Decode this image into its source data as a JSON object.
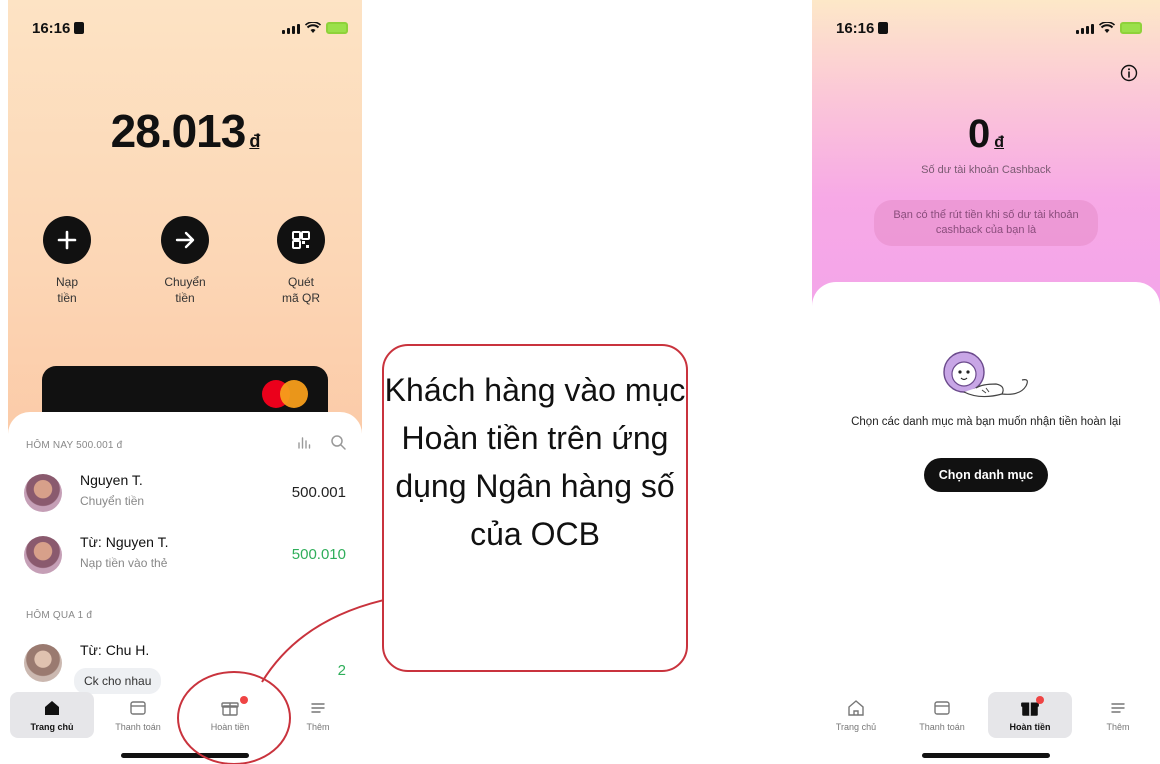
{
  "left_phone": {
    "status_time": "16:16",
    "balance": "28.013",
    "currency": "đ",
    "actions": [
      {
        "label": "Nạp\ntiền",
        "icon": "plus-icon"
      },
      {
        "label": "Chuyển\ntiền",
        "icon": "arrow-right-icon"
      },
      {
        "label": "Quét\nmã QR",
        "icon": "qr-icon"
      }
    ],
    "today_header": "HÔM NAY 500.001 đ",
    "yesterday_header": "HÔM QUA 1 đ",
    "transactions": [
      {
        "name": "Nguyen T.",
        "desc": "Chuyển tiền",
        "amount": "500.001"
      },
      {
        "name": "Từ: Nguyen T.",
        "desc": "Nạp tiền vào thẻ",
        "amount": "500.010"
      },
      {
        "name": "Từ: Chu H.",
        "desc": "Ck cho nhau",
        "amount": "2"
      }
    ],
    "tabs": [
      {
        "label": "Trang chủ",
        "icon": "home-icon"
      },
      {
        "label": "Thanh toán",
        "icon": "wallet-icon"
      },
      {
        "label": "Hoàn tiền",
        "icon": "gift-icon"
      },
      {
        "label": "Thêm",
        "icon": "menu-icon"
      }
    ],
    "active_tab": "Trang chủ"
  },
  "callout": {
    "text": "Khách hàng vào mục Hoàn tiền trên ứng dụng Ngân hàng số của OCB"
  },
  "right_phone": {
    "status_time": "16:16",
    "cashback_amount": "0",
    "currency": "đ",
    "cashback_label": "Số dư tài khoản Cashback",
    "withdraw_note": "Bạn có thể rút tiền khi số dư tài khoản cashback của bạn là",
    "empty_text": "Chọn các danh mục mà bạn muốn nhận tiền hoàn lại",
    "choose_button": "Chọn danh mục",
    "tabs": [
      {
        "label": "Trang chủ",
        "icon": "home-icon"
      },
      {
        "label": "Thanh toán",
        "icon": "wallet-icon"
      },
      {
        "label": "Hoàn tiền",
        "icon": "gift-icon"
      },
      {
        "label": "Thêm",
        "icon": "menu-icon"
      }
    ],
    "active_tab": "Hoàn tiền"
  },
  "colors": {
    "positive_amount": "#2fae5a",
    "callout_border": "#c9333d",
    "notification_dot": "#ef4444",
    "mastercard_red": "#eb001b",
    "mastercard_orange": "#f79e1b"
  }
}
